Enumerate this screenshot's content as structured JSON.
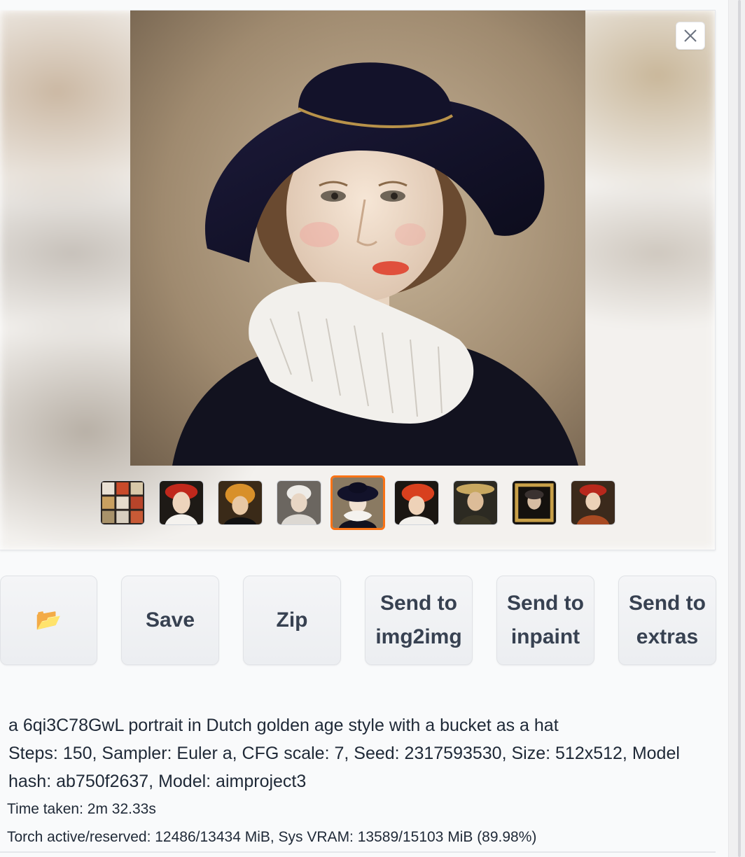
{
  "gallery": {
    "close_label": "×",
    "thumbnails": [
      {
        "name": "grid",
        "bg": "#2a2420"
      },
      {
        "name": "red-beret",
        "bg": "#1e1a16"
      },
      {
        "name": "golden-hat",
        "bg": "#3a2a18"
      },
      {
        "name": "bonnet",
        "bg": "#6b6660"
      },
      {
        "name": "black-hat",
        "bg": "#8a7a62"
      },
      {
        "name": "red-turban",
        "bg": "#1a1612"
      },
      {
        "name": "straw-hat",
        "bg": "#2c2a22"
      },
      {
        "name": "framed",
        "bg": "#14110e"
      },
      {
        "name": "red-cap",
        "bg": "#3b2a1c"
      }
    ],
    "selected_index": 4
  },
  "actions": {
    "folder_icon": "📂",
    "save_label": "Save",
    "zip_label": "Zip",
    "send_img2img_line1": "Send to",
    "send_img2img_line2": "img2img",
    "send_inpaint_line1": "Send to",
    "send_inpaint_line2": "inpaint",
    "send_extras_line1": "Send to",
    "send_extras_line2": "extras"
  },
  "info": {
    "prompt": "a 6qi3C78GwL portrait in Dutch golden age style with a bucket as a hat",
    "params_line1": "Steps: 150, Sampler: Euler a, CFG scale: 7, Seed: 2317593530, Size: 512x512, Model",
    "params_line2": "hash: ab750f2637, Model: aimproject3",
    "time_taken": "Time taken: 2m 32.33s",
    "vram": "Torch active/reserved: 12486/13434 MiB, Sys VRAM: 13589/15103 MiB (89.98%)"
  },
  "colors": {
    "accent": "#f97316",
    "button_text": "#374151"
  }
}
